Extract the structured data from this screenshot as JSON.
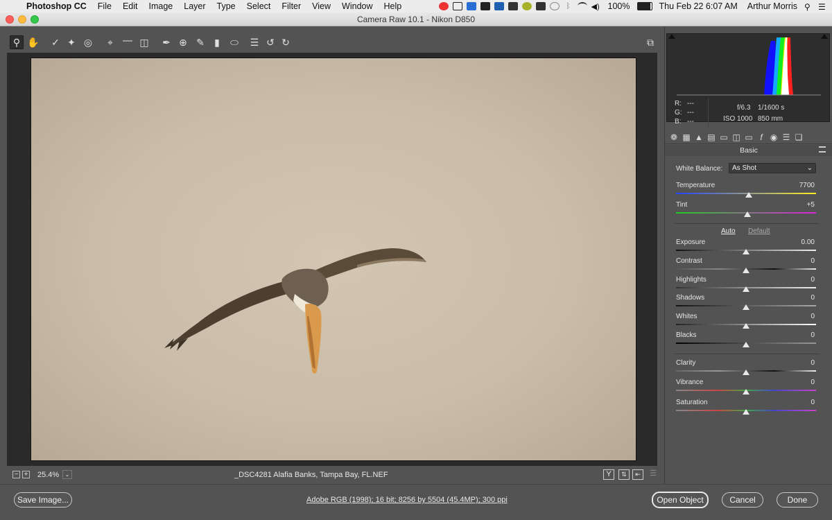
{
  "menubar": {
    "app_name": "Photoshop CC",
    "menus": [
      "File",
      "Edit",
      "Image",
      "Layer",
      "Type",
      "Select",
      "Filter",
      "View",
      "Window",
      "Help"
    ],
    "battery": "100%",
    "datetime": "Thu Feb 22  6:07 AM",
    "user": "Arthur Morris"
  },
  "window": {
    "title": "Camera Raw 10.1  -  Nikon D850"
  },
  "toolbar": {
    "tools": [
      "zoom-tool",
      "hand-tool",
      "white-balance-tool",
      "color-sampler-tool",
      "targeted-adjustment-tool",
      "crop-tool",
      "straighten-tool",
      "transform-tool",
      "spot-removal-tool",
      "red-eye-removal-tool",
      "adjustment-brush-tool",
      "graduated-filter-tool",
      "radial-filter-tool",
      "preferences-tool",
      "rotate-ccw-tool",
      "rotate-cw-tool"
    ],
    "active_tool": "zoom-tool"
  },
  "preview": {
    "zoom_level": "25.4%",
    "filename": "_DSC4281  Alafia Banks, Tampa Bay, FL.NEF",
    "compare_labels": [
      "Y"
    ]
  },
  "readout": {
    "r_label": "R:",
    "r_value": "---",
    "g_label": "G:",
    "g_value": "---",
    "b_label": "B:",
    "b_value": "---",
    "aperture": "f/6.3",
    "shutter": "1/1600 s",
    "iso": "ISO 1000",
    "focal": "850 mm"
  },
  "panel": {
    "section_title": "Basic",
    "white_balance_label": "White Balance:",
    "white_balance_value": "As Shot",
    "auto_label": "Auto",
    "default_label": "Default",
    "sliders": [
      {
        "label": "Temperature",
        "value": "7700",
        "level": 0.52
      },
      {
        "label": "Tint",
        "value": "+5",
        "level": 0.51
      },
      {
        "label": "Exposure",
        "value": "0.00",
        "level": 0.5
      },
      {
        "label": "Contrast",
        "value": "0",
        "level": 0.5
      },
      {
        "label": "Highlights",
        "value": "0",
        "level": 0.5
      },
      {
        "label": "Shadows",
        "value": "0",
        "level": 0.5
      },
      {
        "label": "Whites",
        "value": "0",
        "level": 0.5
      },
      {
        "label": "Blacks",
        "value": "0",
        "level": 0.5
      },
      {
        "label": "Clarity",
        "value": "0",
        "level": 0.5
      },
      {
        "label": "Vibrance",
        "value": "0",
        "level": 0.5
      },
      {
        "label": "Saturation",
        "value": "0",
        "level": 0.5
      }
    ]
  },
  "footer": {
    "save_label": "Save Image...",
    "workflow_text": "Adobe RGB (1998); 16 bit; 8256 by 5504 (45.4MP); 300 ppi",
    "open_label": "Open Object",
    "cancel_label": "Cancel",
    "done_label": "Done"
  }
}
